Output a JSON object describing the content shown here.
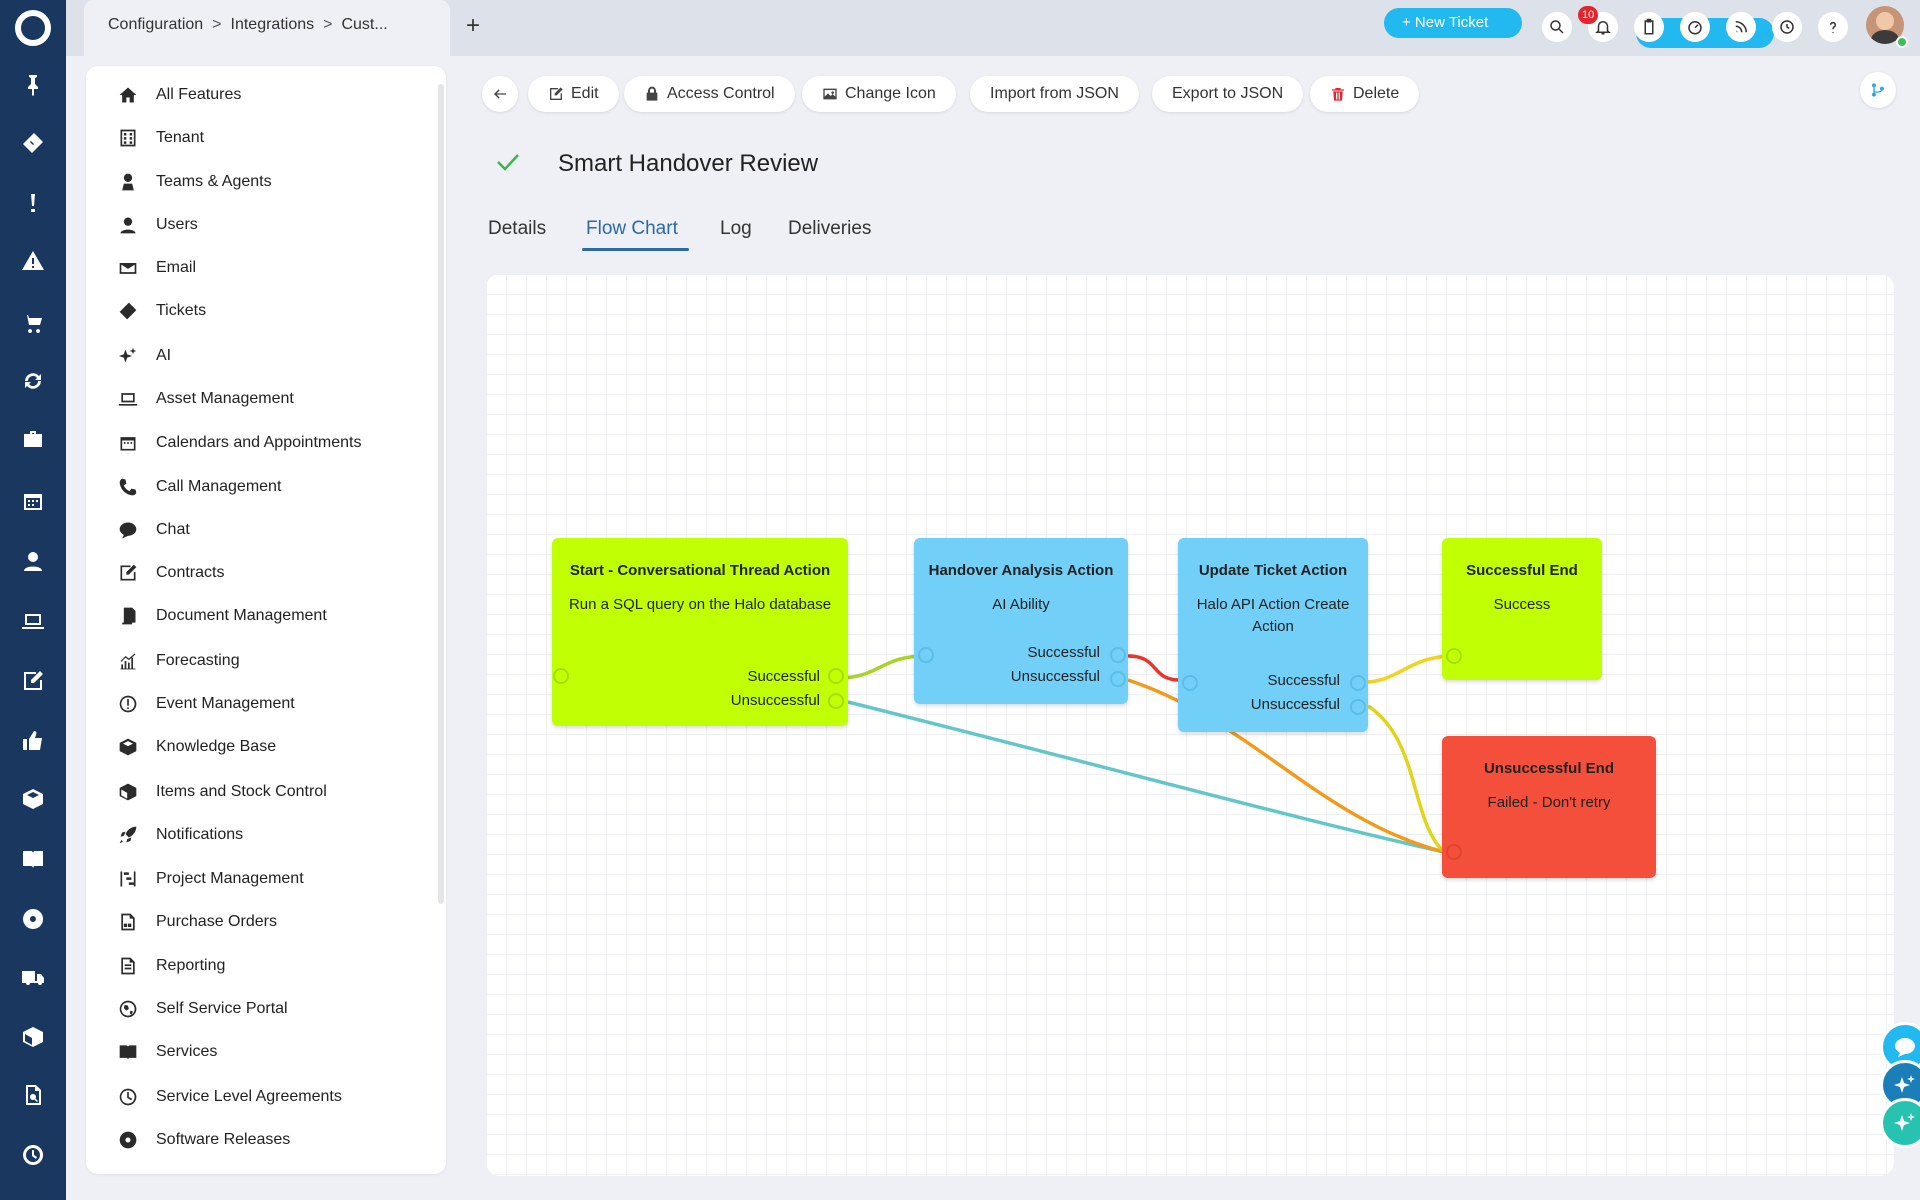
{
  "breadcrumb": {
    "items": [
      "Configuration",
      "Integrations",
      "Cust..."
    ]
  },
  "header": {
    "new_ticket_label": "+ New Ticket",
    "notification_count": "10"
  },
  "rail": {
    "icons": [
      "home-logo",
      "pin",
      "ticket",
      "exclamation",
      "warning",
      "cart",
      "refresh",
      "briefcase",
      "calendar",
      "user",
      "laptop",
      "edit",
      "thumbs-up",
      "box",
      "book",
      "disc",
      "truck",
      "package",
      "document-search",
      "clock"
    ]
  },
  "config_menu": {
    "items": [
      {
        "label": "All Features",
        "icon": "home-icon"
      },
      {
        "label": "Tenant",
        "icon": "building-icon"
      },
      {
        "label": "Teams & Agents",
        "icon": "agent-icon"
      },
      {
        "label": "Users",
        "icon": "user-icon"
      },
      {
        "label": "Email",
        "icon": "envelope-icon"
      },
      {
        "label": "Tickets",
        "icon": "ticket-icon"
      },
      {
        "label": "AI",
        "icon": "sparkle-icon"
      },
      {
        "label": "Asset Management",
        "icon": "laptop-icon"
      },
      {
        "label": "Calendars and Appointments",
        "icon": "calendar-icon"
      },
      {
        "label": "Call Management",
        "icon": "phone-icon"
      },
      {
        "label": "Chat",
        "icon": "chat-icon"
      },
      {
        "label": "Contracts",
        "icon": "contract-icon"
      },
      {
        "label": "Document Management",
        "icon": "documents-icon"
      },
      {
        "label": "Forecasting",
        "icon": "chart-icon"
      },
      {
        "label": "Event Management",
        "icon": "alert-circle-icon"
      },
      {
        "label": "Knowledge Base",
        "icon": "boxes-icon"
      },
      {
        "label": "Items and Stock Control",
        "icon": "box-icon"
      },
      {
        "label": "Notifications",
        "icon": "rocket-icon"
      },
      {
        "label": "Project Management",
        "icon": "project-icon"
      },
      {
        "label": "Purchase Orders",
        "icon": "po-icon"
      },
      {
        "label": "Reporting",
        "icon": "report-icon"
      },
      {
        "label": "Self Service Portal",
        "icon": "globe-icon"
      },
      {
        "label": "Services",
        "icon": "book-icon"
      },
      {
        "label": "Service Level Agreements",
        "icon": "timer-icon"
      },
      {
        "label": "Software Releases",
        "icon": "disc-icon"
      }
    ]
  },
  "toolbar": {
    "edit": "Edit",
    "access_control": "Access Control",
    "change_icon": "Change Icon",
    "import_json": "Import from JSON",
    "export_json": "Export to JSON",
    "delete": "Delete"
  },
  "page": {
    "title": "Smart Handover Review"
  },
  "tabs": [
    "Details",
    "Flow Chart",
    "Log",
    "Deliveries"
  ],
  "active_tab": "Flow Chart",
  "flow": {
    "nodes": [
      {
        "id": "start",
        "title": "Start - Conversational Thread Action",
        "description": "Run a SQL query on the Halo database",
        "outputs": [
          "Successful",
          "Unsuccessful"
        ],
        "color": "#c1ff05"
      },
      {
        "id": "handover",
        "title": "Handover Analysis Action",
        "description": "AI Ability",
        "outputs": [
          "Successful",
          "Unsuccessful"
        ],
        "color": "#72cff8"
      },
      {
        "id": "update",
        "title": "Update Ticket Action",
        "description": "Halo API Action Create Action",
        "outputs": [
          "Successful",
          "Unsuccessful"
        ],
        "color": "#72cff8"
      },
      {
        "id": "success_end",
        "title": "Successful End",
        "description": "Success",
        "outputs": [],
        "color": "#c1ff05"
      },
      {
        "id": "fail_end",
        "title": "Unsuccessful End",
        "description": "Failed - Don't retry",
        "outputs": [],
        "color": "#f44f3b"
      }
    ],
    "links": [
      {
        "from": "start.Successful",
        "to": "handover",
        "color": "#a8d428"
      },
      {
        "from": "start.Unsuccessful",
        "to": "fail_end",
        "color": "#63c6c8"
      },
      {
        "from": "handover.Successful",
        "to": "update",
        "color": "#e8362a"
      },
      {
        "from": "handover.Unsuccessful",
        "to": "fail_end",
        "color": "#f29a1c"
      },
      {
        "from": "update.Successful",
        "to": "success_end",
        "color": "#f2d21c"
      },
      {
        "from": "update.Unsuccessful",
        "to": "fail_end",
        "color": "#e0d41c"
      }
    ]
  }
}
